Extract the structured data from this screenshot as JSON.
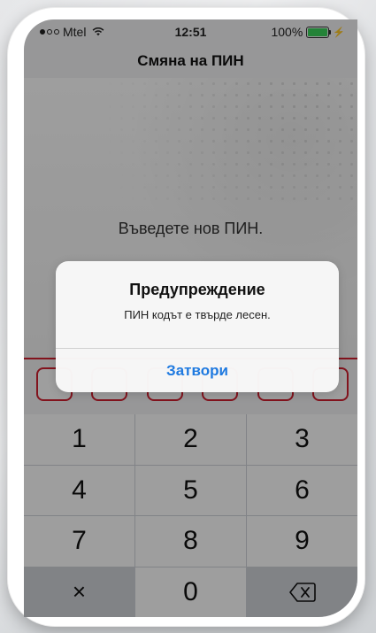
{
  "status_bar": {
    "carrier": "Mtel",
    "time": "12:51",
    "battery_percent": "100%",
    "signal_dots_filled": 1,
    "signal_dots_total": 3,
    "battery_fill_fraction": 1.0,
    "battery_color": "#3bd35b"
  },
  "nav": {
    "title": "Смяна на ПИН"
  },
  "pin_entry": {
    "prompt": "Въведете нов ПИН.",
    "digit_slots": 6,
    "accent_color": "#d21f2f"
  },
  "alert": {
    "title": "Предупреждение",
    "message": "ПИН кодът е твърде лесен.",
    "close_label": "Затвори",
    "button_color": "#1f7ae0"
  },
  "keypad": {
    "keys": [
      "1",
      "2",
      "3",
      "4",
      "5",
      "6",
      "7",
      "8",
      "9",
      "×",
      "0"
    ],
    "delete_icon": "backspace-icon",
    "clear_icon": "clear-icon"
  }
}
